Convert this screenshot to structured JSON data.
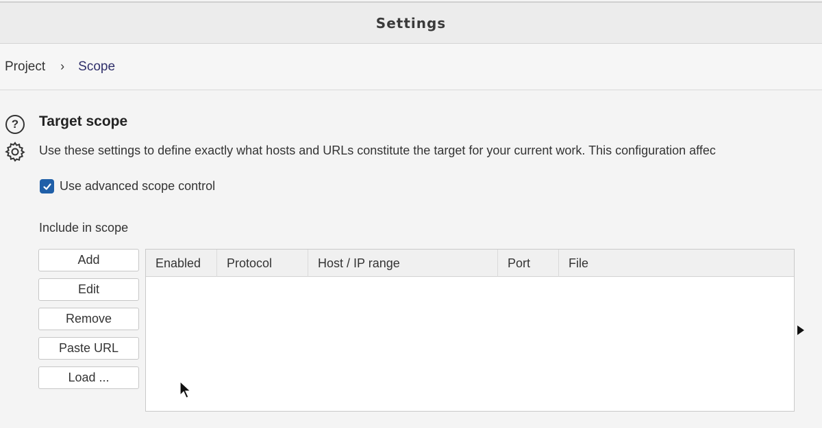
{
  "window": {
    "title": "Settings"
  },
  "breadcrumb": {
    "items": [
      "Project",
      "Scope"
    ],
    "separator": "›"
  },
  "section": {
    "title": "Target scope",
    "description": "Use these settings to define exactly what hosts and URLs constitute the target for your current work. This configuration affec",
    "help_icon_glyph": "?"
  },
  "advanced_scope": {
    "label": "Use advanced scope control",
    "checked": true
  },
  "include_scope": {
    "label": "Include in scope",
    "buttons": {
      "add": "Add",
      "edit": "Edit",
      "remove": "Remove",
      "paste_url": "Paste URL",
      "load": "Load ..."
    },
    "columns": [
      "Enabled",
      "Protocol",
      "Host / IP range",
      "Port",
      "File"
    ],
    "rows": []
  },
  "colors": {
    "checkbox": "#1f5fa8",
    "breadcrumb_current": "#2f2f6a"
  }
}
